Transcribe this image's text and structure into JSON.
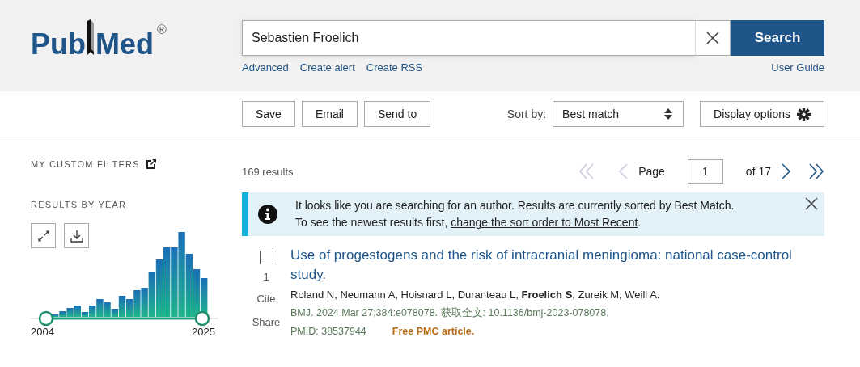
{
  "logo": {
    "pub": "Pub",
    "med": "Med",
    "mark": "®"
  },
  "search": {
    "value": "Sebastien Froelich",
    "button": "Search",
    "links": [
      "Advanced",
      "Create alert",
      "Create RSS"
    ],
    "guide": "User Guide"
  },
  "toolbar": {
    "buttons": [
      "Save",
      "Email",
      "Send to"
    ],
    "sort_label": "Sort by:",
    "sort_value": "Best match",
    "display": "Display options"
  },
  "sidebar": {
    "custom_filters": "MY CUSTOM FILTERS",
    "by_year": "RESULTS BY YEAR",
    "year_start": "2004",
    "year_end": "2025"
  },
  "results": {
    "count": "169 results",
    "page_label": "Page",
    "page": "1",
    "of": "of 17"
  },
  "notice": {
    "line1": "It looks like you are searching for an author. Results are currently sorted by Best Match.",
    "line2": "To see the newest results first,",
    "link": "change the sort order to Most Recent",
    "end": "."
  },
  "articles": [
    {
      "number": "1",
      "title": "Use of progestogens and the risk of intracranial meningioma: national case-control study.",
      "authors": "Roland N, Neumann A, Hoisnard L, Duranteau L, **Froelich S**, Zureik M, Weill A.",
      "citation": "BMJ. 2024 Mar 27;384:e078078. 获取全文: 10.1136/bmj-2023-078078.",
      "pmid": "PMID: 38537944",
      "free": "Free PMC article.",
      "checked": false,
      "cite": "Cite",
      "share": "Share"
    }
  ]
}
